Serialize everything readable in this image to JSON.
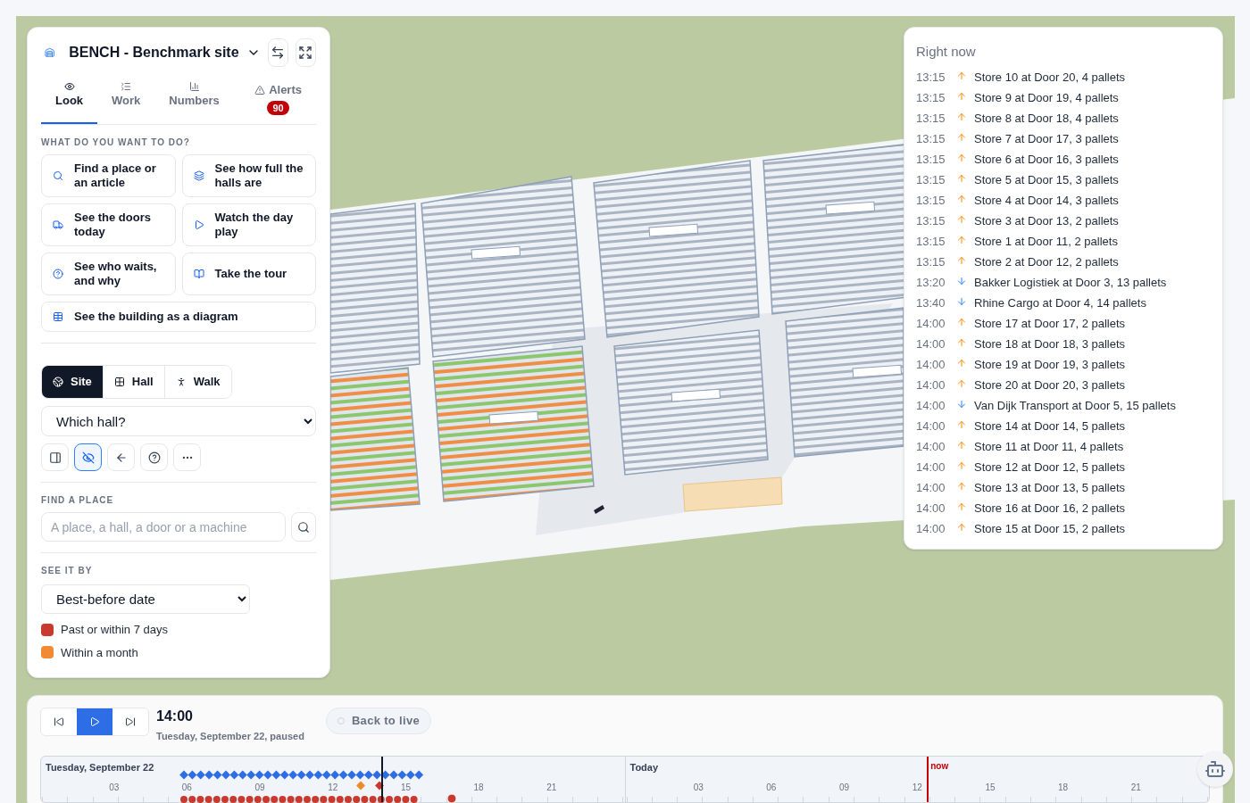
{
  "site": {
    "title": "BENCH - Benchmark site"
  },
  "tabs": [
    {
      "label": "Look",
      "selected": true
    },
    {
      "label": "Work",
      "selected": false
    },
    {
      "label": "Numbers",
      "selected": false
    },
    {
      "label": "Alerts",
      "selected": false,
      "badge": "90"
    }
  ],
  "actions": {
    "heading": "WHAT DO YOU WANT TO DO?",
    "items": [
      {
        "label": "Find a place or an article",
        "kind": "tile"
      },
      {
        "label": "See how full the halls are",
        "kind": "tile"
      },
      {
        "label": "See the doors today",
        "kind": "tile"
      },
      {
        "label": "Watch the day play",
        "kind": "tile"
      },
      {
        "label": "See who waits, and why",
        "kind": "tile"
      },
      {
        "label": "Take the tour",
        "kind": "tile"
      },
      {
        "label": "See the building as a diagram",
        "kind": "wide"
      }
    ]
  },
  "view_modes": [
    {
      "label": "Site",
      "selected": true
    },
    {
      "label": "Hall",
      "selected": false
    },
    {
      "label": "Walk",
      "selected": false
    }
  ],
  "hall_select": {
    "value": "Which hall?"
  },
  "tools": [
    {
      "selected": false
    },
    {
      "selected": true
    },
    {
      "selected": false
    },
    {
      "selected": false
    },
    {
      "selected": false
    }
  ],
  "find": {
    "heading": "FIND A PLACE",
    "placeholder": "A place, a hall, a door or a machine"
  },
  "see_by": {
    "heading": "SEE IT BY",
    "value": "Best-before date",
    "legend": [
      {
        "label": "Past or within 7 days",
        "color": "#c83a2f"
      },
      {
        "label": "Within a month",
        "color": "#f08a35"
      }
    ]
  },
  "right_now": {
    "title": "Right now",
    "events": [
      {
        "time": "13:15",
        "kind": "out",
        "text": "Store 10 at Door 20, 4 pallets"
      },
      {
        "time": "13:15",
        "kind": "out",
        "text": "Store 9 at Door 19, 4 pallets"
      },
      {
        "time": "13:15",
        "kind": "out",
        "text": "Store 8 at Door 18, 4 pallets"
      },
      {
        "time": "13:15",
        "kind": "out",
        "text": "Store 7 at Door 17, 3 pallets"
      },
      {
        "time": "13:15",
        "kind": "out",
        "text": "Store 6 at Door 16, 3 pallets"
      },
      {
        "time": "13:15",
        "kind": "out",
        "text": "Store 5 at Door 15, 3 pallets"
      },
      {
        "time": "13:15",
        "kind": "out",
        "text": "Store 4 at Door 14, 3 pallets"
      },
      {
        "time": "13:15",
        "kind": "out",
        "text": "Store 3 at Door 13, 2 pallets"
      },
      {
        "time": "13:15",
        "kind": "out",
        "text": "Store 1 at Door 11, 2 pallets"
      },
      {
        "time": "13:15",
        "kind": "out",
        "text": "Store 2 at Door 12, 2 pallets"
      },
      {
        "time": "13:20",
        "kind": "in",
        "text": "Bakker Logistiek at Door 3, 13 pallets"
      },
      {
        "time": "13:40",
        "kind": "in",
        "text": "Rhine Cargo at Door 4, 14 pallets"
      },
      {
        "time": "14:00",
        "kind": "out",
        "text": "Store 17 at Door 17, 2 pallets"
      },
      {
        "time": "14:00",
        "kind": "out",
        "text": "Store 18 at Door 18, 3 pallets"
      },
      {
        "time": "14:00",
        "kind": "out",
        "text": "Store 19 at Door 19, 3 pallets"
      },
      {
        "time": "14:00",
        "kind": "out",
        "text": "Store 20 at Door 20, 3 pallets"
      },
      {
        "time": "14:00",
        "kind": "in",
        "text": "Van Dijk Transport at Door 5, 15 pallets"
      },
      {
        "time": "14:00",
        "kind": "out",
        "text": "Store 14 at Door 14, 5 pallets"
      },
      {
        "time": "14:00",
        "kind": "out",
        "text": "Store 11 at Door 11, 4 pallets"
      },
      {
        "time": "14:00",
        "kind": "out",
        "text": "Store 12 at Door 12, 5 pallets"
      },
      {
        "time": "14:00",
        "kind": "out",
        "text": "Store 13 at Door 13, 5 pallets"
      },
      {
        "time": "14:00",
        "kind": "out",
        "text": "Store 16 at Door 16, 2 pallets"
      },
      {
        "time": "14:00",
        "kind": "out",
        "text": "Store 15 at Door 15, 2 pallets"
      }
    ]
  },
  "player": {
    "controls": [
      {
        "kind": "back",
        "selected": false
      },
      {
        "kind": "play",
        "selected": true
      },
      {
        "kind": "forward",
        "selected": false
      }
    ],
    "time": "14:00",
    "subtitle": "Tuesday, September 22, paused",
    "live_button": "Back to live"
  },
  "timeline": {
    "days": [
      {
        "label": "Tuesday, September 22",
        "ticks": [
          "03",
          "06",
          "09",
          "12",
          "15",
          "18",
          "21"
        ]
      },
      {
        "label": "Today",
        "ticks": [
          "03",
          "06",
          "09",
          "12",
          "15",
          "18",
          "21"
        ]
      }
    ],
    "now_label": "now"
  }
}
